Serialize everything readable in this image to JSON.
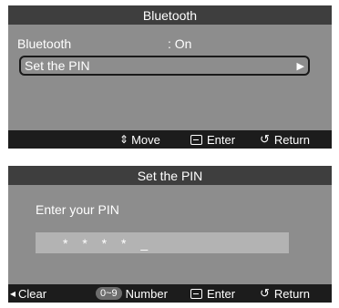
{
  "bluetooth_menu": {
    "title": "Bluetooth",
    "items": [
      {
        "label": "Bluetooth",
        "value": ": On"
      },
      {
        "label": "Set the PIN",
        "arrow": "▶"
      }
    ],
    "footer": {
      "move_glyph": "⇕",
      "move": "Move",
      "enter": "Enter",
      "return": "Return"
    }
  },
  "pin_dialog": {
    "title": "Set the PIN",
    "prompt": "Enter your PIN",
    "pin_display": "* * * * _",
    "footer": {
      "clear_glyph": "◂",
      "clear": "Clear",
      "number_badge": "0~9",
      "number": "Number",
      "enter": "Enter",
      "return": "Return"
    }
  }
}
